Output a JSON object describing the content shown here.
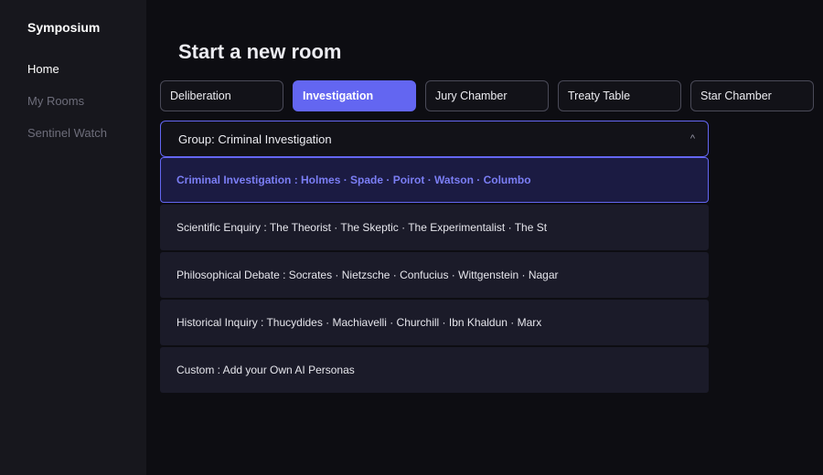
{
  "sidebar": {
    "brand": "Symposium",
    "items": [
      {
        "label": "Home",
        "active": true
      },
      {
        "label": "My Rooms",
        "active": false
      },
      {
        "label": "Sentinel Watch",
        "active": false
      }
    ]
  },
  "main": {
    "title": "Start a new room",
    "tabs": [
      {
        "label": "Deliberation",
        "active": false
      },
      {
        "label": "Investigation",
        "active": true
      },
      {
        "label": "Jury Chamber",
        "active": false
      },
      {
        "label": "Treaty Table",
        "active": false
      },
      {
        "label": "Star Chamber",
        "active": false
      }
    ],
    "group_select": {
      "label": "Group: Criminal Investigation",
      "caret": "^"
    },
    "options": [
      {
        "label": "Criminal Investigation : Holmes · Spade · Poirot · Watson · Columbo",
        "selected": true
      },
      {
        "label": "Scientific Enquiry : The Theorist · The Skeptic · The Experimentalist · The St",
        "selected": false
      },
      {
        "label": "Philosophical Debate : Socrates · Nietzsche · Confucius · Wittgenstein · Nagar",
        "selected": false
      },
      {
        "label": "Historical Inquiry : Thucydides · Machiavelli · Churchill · Ibn Khaldun · Marx",
        "selected": false
      },
      {
        "label": "Custom : Add your Own AI Personas",
        "selected": false
      }
    ]
  },
  "colors": {
    "accent": "#6366f1",
    "sidebar_bg": "#17171d",
    "main_bg": "#0d0d12",
    "option_bg": "#1b1b29"
  }
}
